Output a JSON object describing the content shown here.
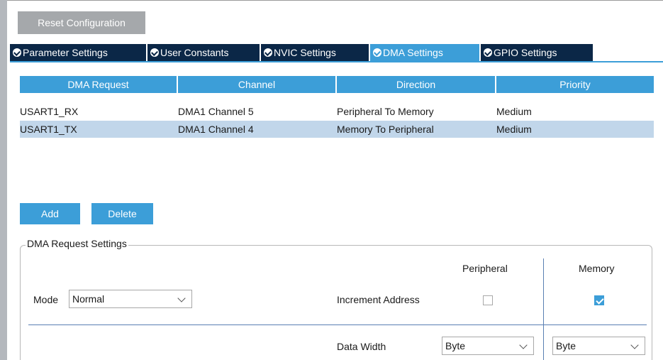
{
  "toolbar": {
    "reset_label": "Reset Configuration"
  },
  "tabs": [
    {
      "label": "Parameter Settings",
      "active": false
    },
    {
      "label": "User Constants",
      "active": false
    },
    {
      "label": "NVIC Settings",
      "active": false
    },
    {
      "label": "DMA Settings",
      "active": true
    },
    {
      "label": "GPIO Settings",
      "active": false
    }
  ],
  "table": {
    "columns": [
      "DMA Request",
      "Channel",
      "Direction",
      "Priority"
    ],
    "rows": [
      [
        "USART1_RX",
        "DMA1 Channel 5",
        "Peripheral To Memory",
        "Medium"
      ],
      [
        "USART1_TX",
        "DMA1 Channel 4",
        "Memory To Peripheral",
        "Medium"
      ]
    ],
    "selected_row": 1
  },
  "actions": {
    "add_label": "Add",
    "delete_label": "Delete"
  },
  "settings": {
    "title": "DMA Request Settings",
    "peripheral_header": "Peripheral",
    "memory_header": "Memory",
    "mode_label": "Mode",
    "mode_value": "Normal",
    "increment_label": "Increment Address",
    "increment_peripheral": false,
    "increment_memory": true,
    "data_width_label": "Data Width",
    "data_width_peripheral": "Byte",
    "data_width_memory": "Byte"
  },
  "colors": {
    "accent": "#3c9ed8",
    "tab_dark": "#0b2747",
    "selected_row": "#c1d6ea",
    "reset_button": "#a5a8ab"
  }
}
